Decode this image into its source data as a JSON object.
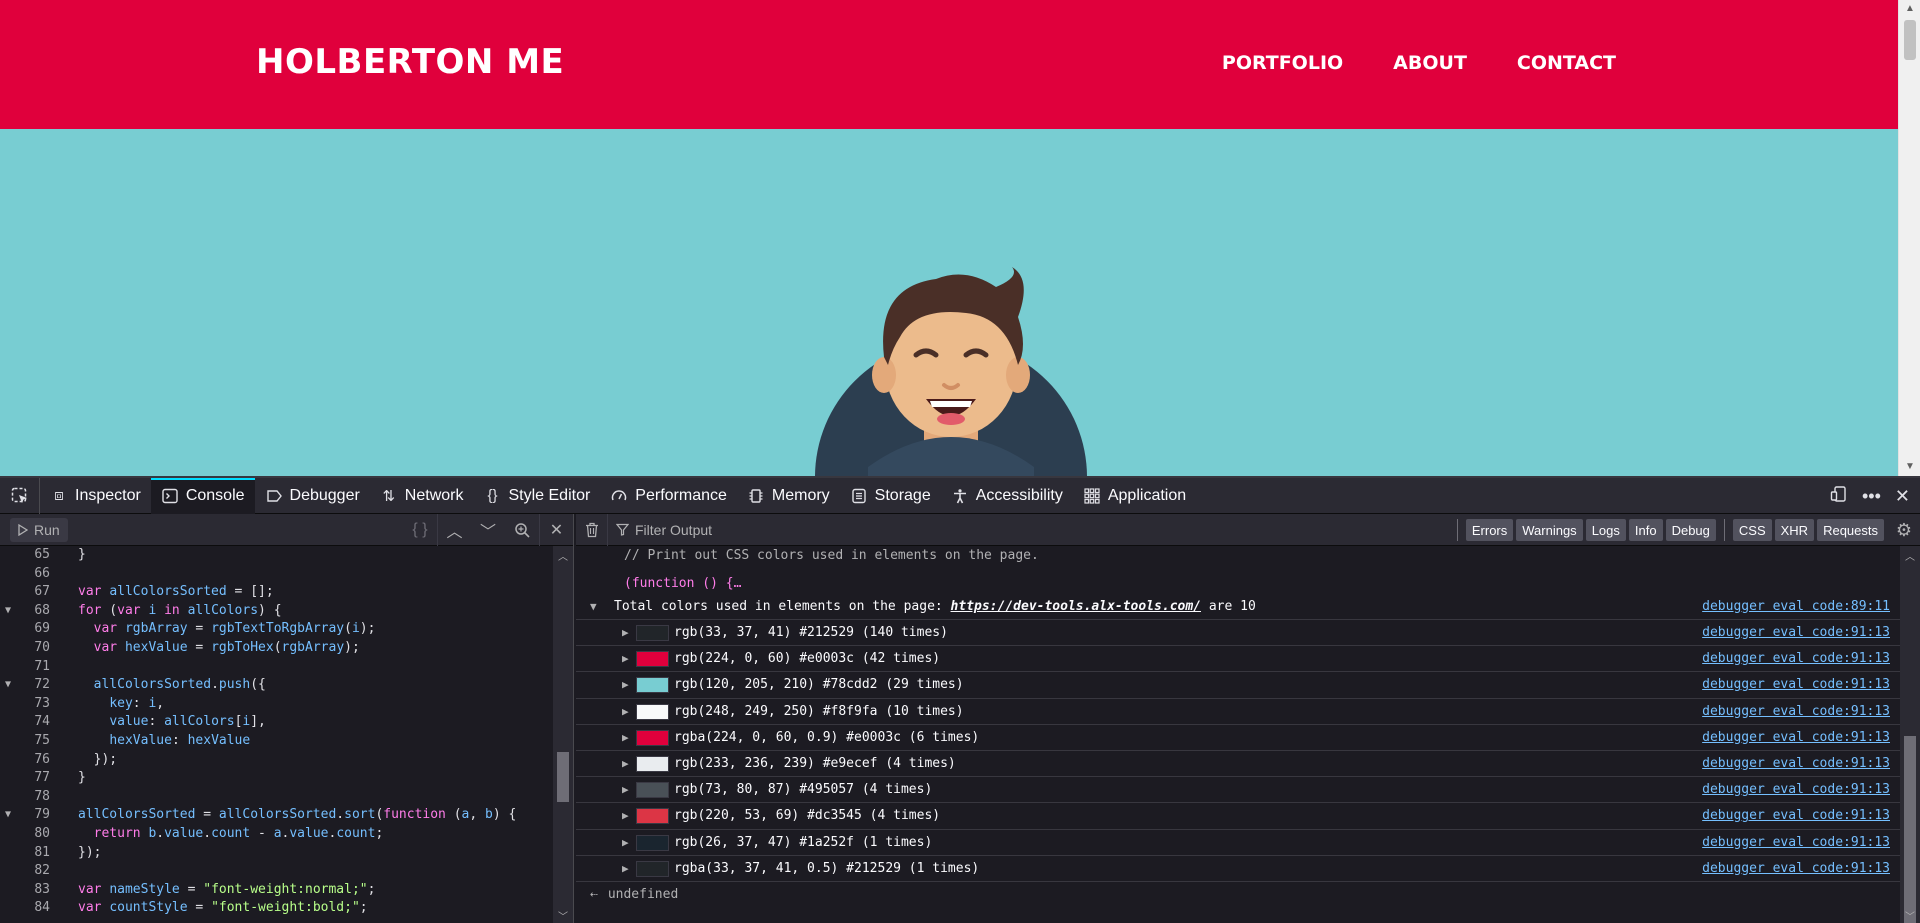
{
  "site": {
    "logo": "HOLBERTON ME",
    "nav": [
      "PORTFOLIO",
      "ABOUT",
      "CONTACT"
    ],
    "colors": {
      "header": "#e0003c",
      "hero": "#78cdd2",
      "avatar_bg": "#212529"
    }
  },
  "devtools": {
    "tabs": [
      {
        "label": "Inspector",
        "icon": "inspector-icon"
      },
      {
        "label": "Console",
        "icon": "console-icon"
      },
      {
        "label": "Debugger",
        "icon": "debugger-icon"
      },
      {
        "label": "Network",
        "icon": "network-icon"
      },
      {
        "label": "Style Editor",
        "icon": "style-editor-icon"
      },
      {
        "label": "Performance",
        "icon": "performance-icon"
      },
      {
        "label": "Memory",
        "icon": "memory-icon"
      },
      {
        "label": "Storage",
        "icon": "storage-icon"
      },
      {
        "label": "Accessibility",
        "icon": "accessibility-icon"
      },
      {
        "label": "Application",
        "icon": "application-icon"
      }
    ],
    "active_tab": "Console",
    "editor": {
      "run_label": "Run",
      "lines": [
        {
          "n": 65,
          "fold": false,
          "code": "}"
        },
        {
          "n": 66,
          "fold": false,
          "code": ""
        },
        {
          "n": 67,
          "fold": false,
          "code": "var allColorsSorted = [];"
        },
        {
          "n": 68,
          "fold": true,
          "code": "for (var i in allColors) {"
        },
        {
          "n": 69,
          "fold": false,
          "code": "  var rgbArray = rgbTextToRgbArray(i);"
        },
        {
          "n": 70,
          "fold": false,
          "code": "  var hexValue = rgbToHex(rgbArray);"
        },
        {
          "n": 71,
          "fold": false,
          "code": ""
        },
        {
          "n": 72,
          "fold": true,
          "code": "  allColorsSorted.push({"
        },
        {
          "n": 73,
          "fold": false,
          "code": "    key: i,"
        },
        {
          "n": 74,
          "fold": false,
          "code": "    value: allColors[i],"
        },
        {
          "n": 75,
          "fold": false,
          "code": "    hexValue: hexValue"
        },
        {
          "n": 76,
          "fold": false,
          "code": "  });"
        },
        {
          "n": 77,
          "fold": false,
          "code": "}"
        },
        {
          "n": 78,
          "fold": false,
          "code": ""
        },
        {
          "n": 79,
          "fold": true,
          "code": "allColorsSorted = allColorsSorted.sort(function (a, b) {"
        },
        {
          "n": 80,
          "fold": false,
          "code": "  return b.value.count - a.value.count;"
        },
        {
          "n": 81,
          "fold": false,
          "code": "});"
        },
        {
          "n": 82,
          "fold": false,
          "code": ""
        },
        {
          "n": 83,
          "fold": false,
          "code": "var nameStyle = \"font-weight:normal;\";"
        },
        {
          "n": 84,
          "fold": false,
          "code": "var countStyle = \"font-weight:bold;\";"
        }
      ]
    },
    "console": {
      "filter_placeholder": "Filter Output",
      "filters": [
        "Errors",
        "Warnings",
        "Logs",
        "Info",
        "Debug"
      ],
      "filters_net": [
        "CSS",
        "XHR",
        "Requests"
      ],
      "input_comment": "// Print out CSS colors used in elements on the page.",
      "input_fn": "(function () {…",
      "header_prefix": "Total colors used in elements on the page: ",
      "header_url": "https://dev-tools.alx-tools.com/",
      "header_suffix": " are 10",
      "header_source": "debugger eval code:89:11",
      "rows": [
        {
          "text": "rgb(33, 37, 41) #212529 (140 times)",
          "swatch": "#212529",
          "source": "debugger eval code:91:13"
        },
        {
          "text": "rgb(224, 0, 60) #e0003c (42 times)",
          "swatch": "#e0003c",
          "source": "debugger eval code:91:13"
        },
        {
          "text": "rgb(120, 205, 210) #78cdd2 (29 times)",
          "swatch": "#78cdd2",
          "source": "debugger eval code:91:13"
        },
        {
          "text": "rgb(248, 249, 250) #f8f9fa (10 times)",
          "swatch": "#f8f9fa",
          "source": "debugger eval code:91:13"
        },
        {
          "text": "rgba(224, 0, 60, 0.9) #e0003c (6 times)",
          "swatch": "#e0003c",
          "source": "debugger eval code:91:13"
        },
        {
          "text": "rgb(233, 236, 239) #e9ecef (4 times)",
          "swatch": "#e9ecef",
          "source": "debugger eval code:91:13"
        },
        {
          "text": "rgb(73, 80, 87) #495057 (4 times)",
          "swatch": "#495057",
          "source": "debugger eval code:91:13"
        },
        {
          "text": "rgb(220, 53, 69) #dc3545 (4 times)",
          "swatch": "#dc3545",
          "source": "debugger eval code:91:13"
        },
        {
          "text": "rgb(26, 37, 47) #1a252f (1 times)",
          "swatch": "#1a252f",
          "source": "debugger eval code:91:13"
        },
        {
          "text": "rgba(33, 37, 41, 0.5) #212529 (1 times)",
          "swatch": "#212529",
          "source": "debugger eval code:91:13"
        }
      ],
      "result": "undefined"
    }
  }
}
